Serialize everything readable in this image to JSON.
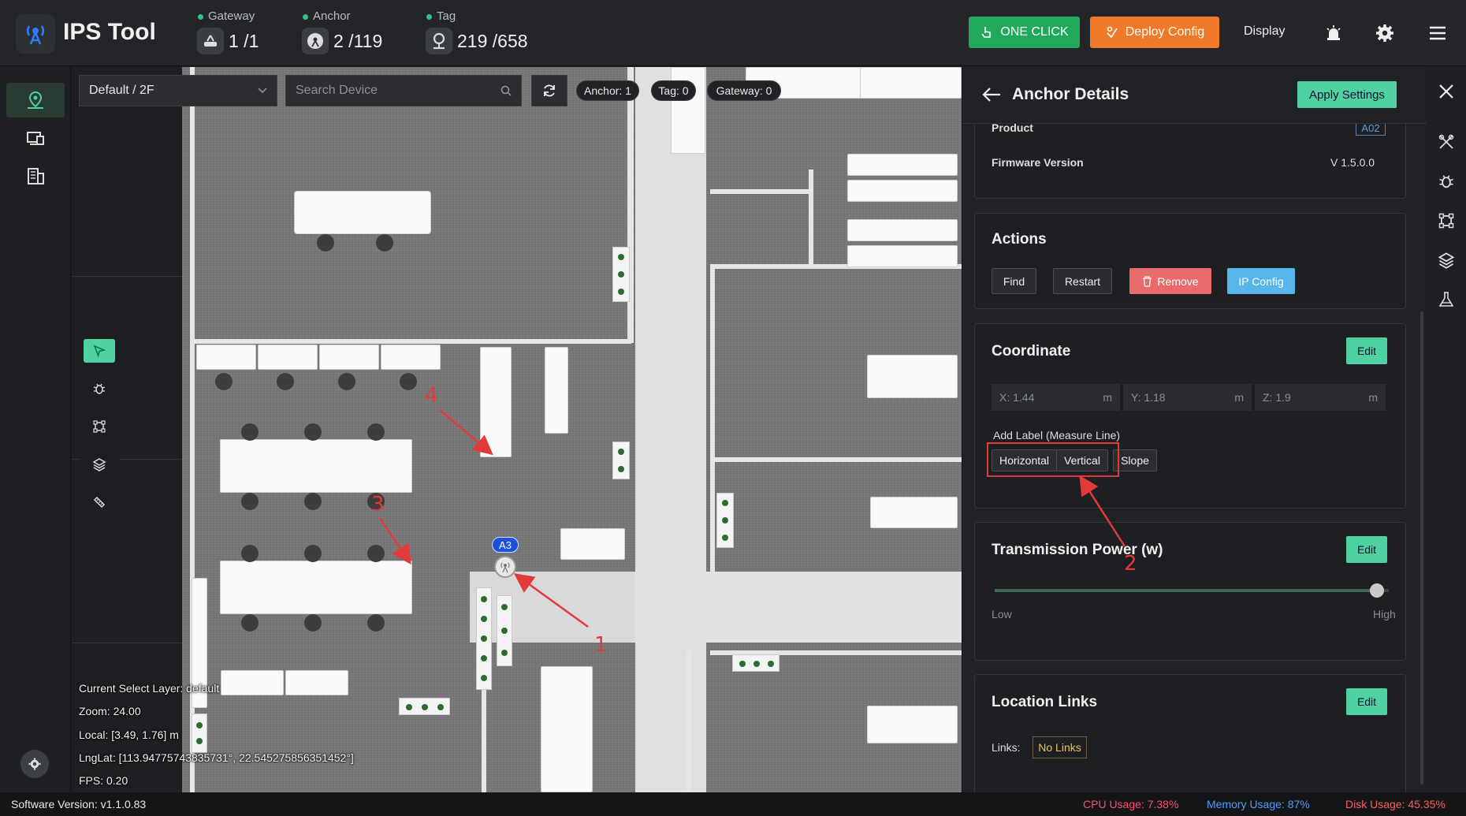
{
  "app": {
    "title": "IPS Tool"
  },
  "stats": {
    "gateway": {
      "label": "Gateway",
      "value": "1 /1"
    },
    "anchor": {
      "label": "Anchor",
      "value": "2 /119"
    },
    "tag": {
      "label": "Tag",
      "value": "219 /658"
    }
  },
  "topbar": {
    "one_click": "ONE CLICK",
    "deploy_config": "Deploy Config",
    "display": "Display",
    "icons": [
      "alarm-icon",
      "gear-icon",
      "menu-icon"
    ]
  },
  "leftnav": {
    "icons": [
      "map-pin-icon",
      "devices-icon",
      "building-icon"
    ]
  },
  "map": {
    "layer_select": "Default / 2F",
    "search_placeholder": "Search Device",
    "pills": {
      "anchor": "Anchor: 1",
      "tag": "Tag: 0",
      "gateway": "Gateway: 0"
    },
    "tools": [
      "pointer-icon",
      "bug-icon",
      "select-area-icon",
      "layers-icon",
      "ruler-icon"
    ],
    "anchor_label": "A3",
    "info": {
      "layer": "Current Select Layer:  default",
      "zoom": "Zoom:  24.00",
      "local": "Local:  [3.49,  1.76] m",
      "lnglat": "LngLat:  [113.94775743835731°,  22.545275856351452°]",
      "fps": "FPS:  0.20"
    },
    "annotations": [
      "1",
      "2",
      "3",
      "4"
    ]
  },
  "panel": {
    "title": "Anchor Details",
    "apply": "Apply Settings",
    "info": {
      "product_label": "Product",
      "product_value": "A02",
      "firmware_label": "Firmware Version",
      "firmware_value": "V 1.5.0.0"
    },
    "actions": {
      "title": "Actions",
      "find": "Find",
      "restart": "Restart",
      "remove": "Remove",
      "ip_config": "IP Config"
    },
    "coordinate": {
      "title": "Coordinate",
      "edit": "Edit",
      "x": "X: 1.44",
      "y": "Y: 1.18",
      "z": "Z: 1.9",
      "unit": "m",
      "add_label": "Add Label (Measure Line)",
      "horizontal": "Horizontal",
      "vertical": "Vertical",
      "slope": "Slope"
    },
    "power": {
      "title": "Transmission Power (w)",
      "edit": "Edit",
      "low": "Low",
      "high": "High",
      "level": 0.97
    },
    "links": {
      "title": "Location Links",
      "edit": "Edit",
      "label": "Links:",
      "value": "No Links"
    }
  },
  "rail": {
    "icons": [
      "tools-icon",
      "bug-icon",
      "select-area-icon",
      "layers-icon",
      "flask-icon"
    ]
  },
  "status": {
    "version": "Software Version:  v1.1.0.83",
    "cpu": "CPU Usage:  7.38%",
    "memory": "Memory Usage:  87%",
    "disk": "Disk Usage:  45.35%"
  },
  "colors": {
    "accent_green": "#4fd1a1",
    "one_click_green": "#22a85a",
    "deploy_orange": "#f07a2a",
    "remove_red": "#e86a6a",
    "ip_blue": "#57b5ea",
    "anchor_blue": "#1d4fe0",
    "annotation_red": "#e23a3a",
    "cpu_color": "#ff4d6d",
    "memory_color": "#4d9dff",
    "disk_color": "#ff5c5c"
  }
}
